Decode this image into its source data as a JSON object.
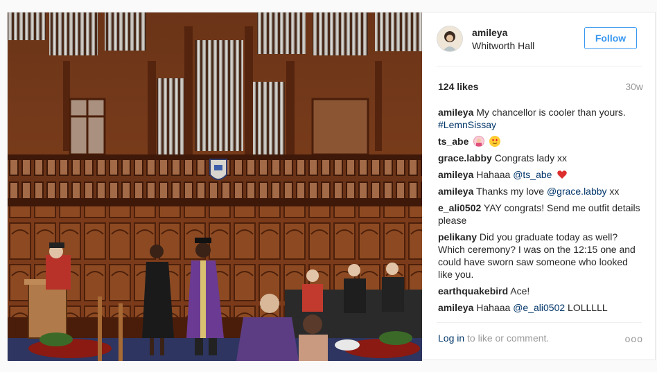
{
  "post": {
    "username": "amileya",
    "location": "Whitworth Hall",
    "follow_label": "Follow",
    "likes": "124 likes",
    "age": "30w",
    "comments": [
      {
        "user": "amileya",
        "text": "My chancellor is cooler than yours. ",
        "tag": "#LemnSissay"
      },
      {
        "user": "ts_abe",
        "emojis": [
          "person-gesturing-emoji",
          "heart-eyes-emoji"
        ]
      },
      {
        "user": "grace.labby",
        "text": "Congrats lady xx"
      },
      {
        "user": "amileya",
        "text": "Hahaaa ",
        "mention": "@ts_abe",
        "emojis": [
          "red-heart-emoji"
        ]
      },
      {
        "user": "amileya",
        "text": "Thanks my love ",
        "mention": "@grace.labby",
        "suffix": " xx"
      },
      {
        "user": "e_ali0502",
        "text": "YAY congrats! Send me outfit details please"
      },
      {
        "user": "pelikany",
        "text": "Did you graduate today as well? Which ceremony? I was on the 12:15 one and could have sworn saw someone who looked like you."
      },
      {
        "user": "earthquakebird",
        "text": "Ace!"
      },
      {
        "user": "amileya",
        "text": "Hahaaa ",
        "mention": "@e_ali0502",
        "suffix": " LOLLLLL"
      }
    ],
    "login_link": "Log in",
    "login_rest": " to like or comment.",
    "more_label": "ooo"
  },
  "colors": {
    "accent": "#3897f0",
    "link": "#003569",
    "muted": "#999999"
  }
}
